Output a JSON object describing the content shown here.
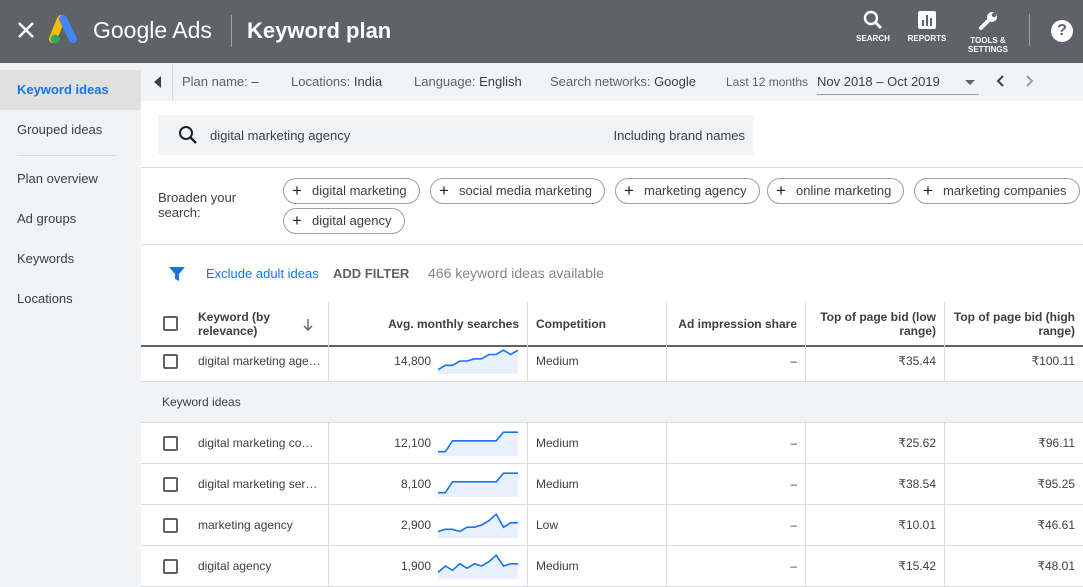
{
  "header": {
    "brand": "Google Ads",
    "title": "Keyword plan",
    "search_label": "SEARCH",
    "reports_label": "REPORTS",
    "tools_label_1": "TOOLS &",
    "tools_label_2": "SETTINGS",
    "help": "?"
  },
  "sidebar": {
    "items": [
      {
        "label": "Keyword ideas"
      },
      {
        "label": "Grouped ideas"
      },
      {
        "label": "Plan overview"
      },
      {
        "label": "Ad groups"
      },
      {
        "label": "Keywords"
      },
      {
        "label": "Locations"
      }
    ]
  },
  "infobar": {
    "plan_label": "Plan name:",
    "plan_value": "–",
    "locations_label": "Locations:",
    "locations_value": "India",
    "language_label": "Language:",
    "language_value": "English",
    "networks_label": "Search networks:",
    "networks_value": "Google",
    "period_label": "Last 12 months",
    "date_range": "Nov 2018 – Oct 2019"
  },
  "search": {
    "query": "digital marketing agency",
    "brand_option": "Including brand names"
  },
  "broaden": {
    "label_1": "Broaden your",
    "label_2": "search:",
    "chips": [
      "digital marketing",
      "social media marketing",
      "marketing agency",
      "online marketing",
      "marketing companies",
      "digital agency"
    ]
  },
  "filter": {
    "exclude_adult": "Exclude adult ideas",
    "add_filter": "ADD FILTER",
    "available": "466 keyword ideas available"
  },
  "table": {
    "headers": {
      "keyword_1": "Keyword (by",
      "keyword_2": "relevance)",
      "searches": "Avg. monthly searches",
      "competition": "Competition",
      "impression": "Ad impression share",
      "low_bid_1": "Top of page bid (low",
      "low_bid_2": "range)",
      "high_bid_1": "Top of page bid (high",
      "high_bid_2": "range)"
    },
    "group_label": "Keyword ideas",
    "provided_row": {
      "keyword": "digital marketing age…",
      "searches": "14,800",
      "competition": "Medium",
      "impression": "–",
      "low_bid": "₹35.44",
      "high_bid": "₹100.11",
      "trend": [
        2,
        4,
        4,
        6,
        6,
        7,
        7,
        9,
        9,
        11,
        9,
        11
      ]
    },
    "rows": [
      {
        "keyword": "digital marketing co…",
        "searches": "12,100",
        "competition": "Medium",
        "impression": "–",
        "low_bid": "₹25.62",
        "high_bid": "₹96.11",
        "trend": [
          2,
          2,
          7,
          7,
          7,
          7,
          7,
          7,
          7,
          11,
          11,
          11
        ]
      },
      {
        "keyword": "digital marketing ser…",
        "searches": "8,100",
        "competition": "Medium",
        "impression": "–",
        "low_bid": "₹38.54",
        "high_bid": "₹95.25",
        "trend": [
          2,
          2,
          7,
          7,
          7,
          7,
          7,
          7,
          7,
          11,
          11,
          11
        ]
      },
      {
        "keyword": "marketing agency",
        "searches": "2,900",
        "competition": "Low",
        "impression": "–",
        "low_bid": "₹10.01",
        "high_bid": "₹46.61",
        "trend": [
          3,
          4,
          4,
          3,
          5,
          5,
          6,
          8,
          11,
          5,
          7,
          7
        ]
      },
      {
        "keyword": "digital agency",
        "searches": "1,900",
        "competition": "Medium",
        "impression": "–",
        "low_bid": "₹15.42",
        "high_bid": "₹48.01",
        "trend": [
          3,
          6,
          4,
          7,
          5,
          7,
          6,
          8,
          11,
          6,
          7,
          7
        ]
      }
    ]
  },
  "colors": {
    "topbar": "#5f6368",
    "accent": "#1a73e8",
    "spark_line": "#1a73e8",
    "spark_fill": "#e8f0fe"
  }
}
